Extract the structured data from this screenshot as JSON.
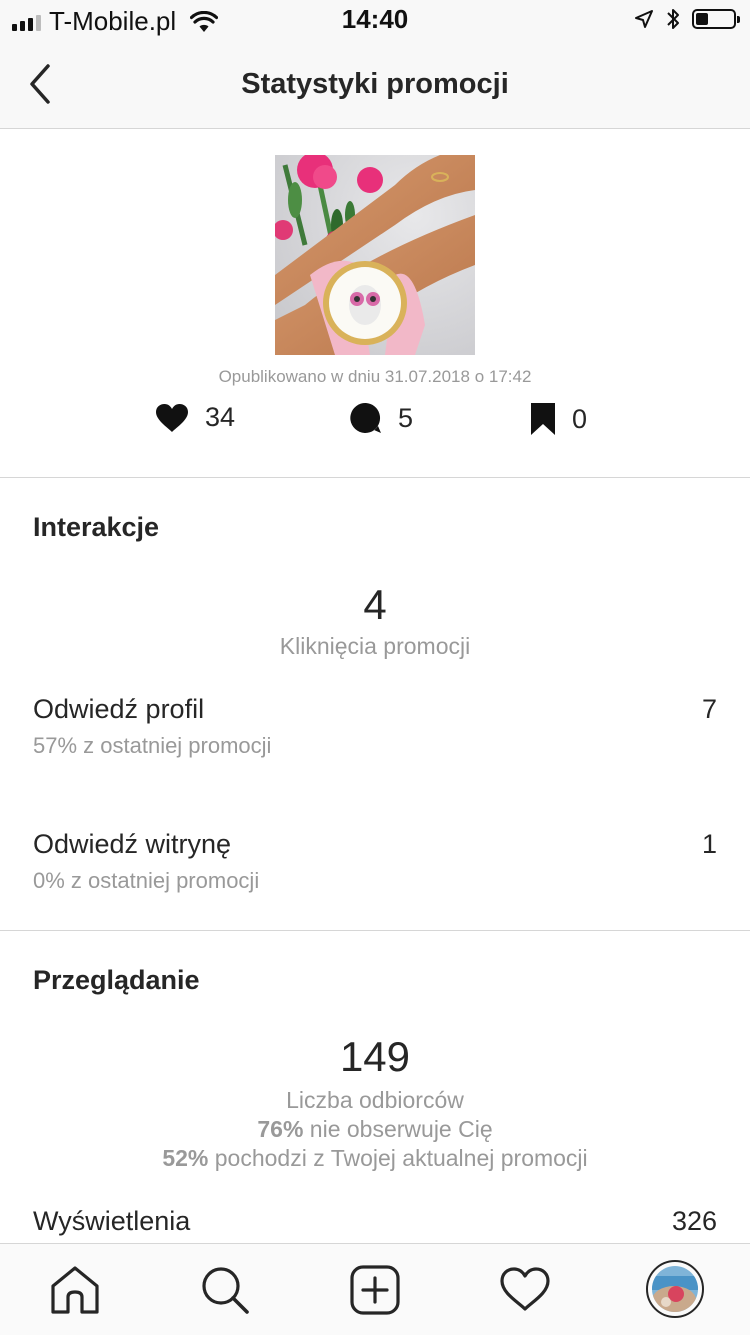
{
  "status_bar": {
    "carrier": "T-Mobile.pl",
    "time": "14:40",
    "icons": [
      "signal-icon",
      "wifi-icon",
      "location-icon",
      "bluetooth-icon",
      "battery-icon"
    ]
  },
  "header": {
    "title": "Statystyki promocji",
    "back_icon": "chevron-left-icon"
  },
  "post": {
    "published": "Opublikowano w dniu 31.07.2018 o 17:42",
    "likes": "34",
    "comments": "5",
    "saves": "0"
  },
  "interactions": {
    "title": "Interakcje",
    "clicks_value": "4",
    "clicks_label": "Kliknięcia promocji",
    "rows": [
      {
        "label": "Odwiedź profil",
        "sub": "57% z ostatniej promocji",
        "value": "7"
      },
      {
        "label": "Odwiedź witrynę",
        "sub": "0% z ostatniej promocji",
        "value": "1"
      }
    ]
  },
  "discovery": {
    "title": "Przeglądanie",
    "reach_value": "149",
    "reach_label": "Liczba odbiorców",
    "not_following_pct": "76%",
    "not_following_text": " nie obserwuje Cię",
    "from_promo_pct": "52%",
    "from_promo_text": " pochodzi z Twojej aktualnej promocji",
    "impressions_label": "Wyświetlenia",
    "impressions_value": "326"
  },
  "tab_bar": {
    "tabs": [
      "home-icon",
      "search-icon",
      "new-post-icon",
      "activity-heart-icon",
      "profile-avatar"
    ]
  }
}
